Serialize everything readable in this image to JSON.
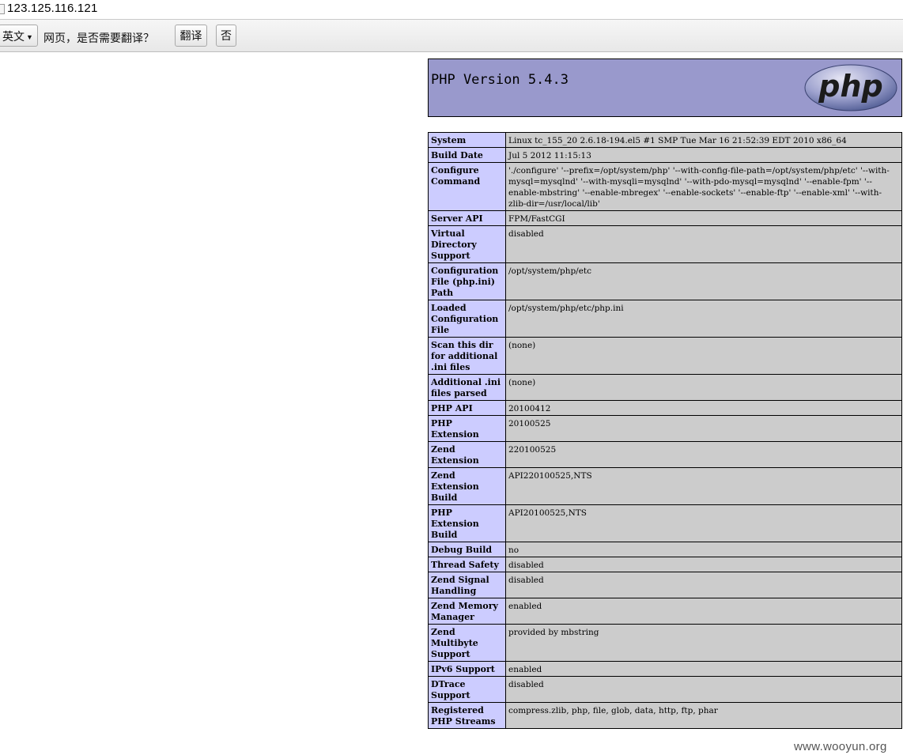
{
  "browser": {
    "address": "123.125.116.121"
  },
  "translate_bar": {
    "language": "英文",
    "prompt": "网页，是否需要翻译？",
    "translate_button": "翻译",
    "no_button": "否"
  },
  "phpinfo": {
    "title": "PHP Version 5.4.3",
    "logo_text": "php",
    "rows": [
      {
        "name": "System",
        "value": "Linux tc_155_20 2.6.18-194.el5 #1 SMP Tue Mar 16 21:52:39 EDT 2010 x86_64"
      },
      {
        "name": "Build Date",
        "value": "Jul 5 2012 11:15:13"
      },
      {
        "name": "Configure Command",
        "value": "'./configure' '--prefix=/opt/system/php' '--with-config-file-path=/opt/system/php/etc' '--with-mysql=mysqlnd' '--with-mysqli=mysqlnd' '--with-pdo-mysql=mysqlnd' '--enable-fpm' '--enable-mbstring' '--enable-mbregex' '--enable-sockets' '--enable-ftp' '--enable-xml' '--with-zlib-dir=/usr/local/lib'"
      },
      {
        "name": "Server API",
        "value": "FPM/FastCGI"
      },
      {
        "name": "Virtual Directory Support",
        "value": "disabled"
      },
      {
        "name": "Configuration File (php.ini) Path",
        "value": "/opt/system/php/etc"
      },
      {
        "name": "Loaded Configuration File",
        "value": "/opt/system/php/etc/php.ini"
      },
      {
        "name": "Scan this dir for additional .ini files",
        "value": "(none)"
      },
      {
        "name": "Additional .ini files parsed",
        "value": "(none)"
      },
      {
        "name": "PHP API",
        "value": "20100412"
      },
      {
        "name": "PHP Extension",
        "value": "20100525"
      },
      {
        "name": "Zend Extension",
        "value": "220100525"
      },
      {
        "name": "Zend Extension Build",
        "value": "API220100525,NTS"
      },
      {
        "name": "PHP Extension Build",
        "value": "API20100525,NTS"
      },
      {
        "name": "Debug Build",
        "value": "no"
      },
      {
        "name": "Thread Safety",
        "value": "disabled"
      },
      {
        "name": "Zend Signal Handling",
        "value": "disabled"
      },
      {
        "name": "Zend Memory Manager",
        "value": "enabled"
      },
      {
        "name": "Zend Multibyte Support",
        "value": "provided by mbstring"
      },
      {
        "name": "IPv6 Support",
        "value": "enabled"
      },
      {
        "name": "DTrace Support",
        "value": "disabled"
      },
      {
        "name": "Registered PHP Streams",
        "value": "compress.zlib, php, file, glob, data, http, ftp, phar"
      }
    ]
  },
  "watermark": "www.wooyun.org",
  "colors": {
    "header_bg": "#9999cc",
    "label_bg": "#ccccff",
    "value_bg": "#cccccc"
  }
}
